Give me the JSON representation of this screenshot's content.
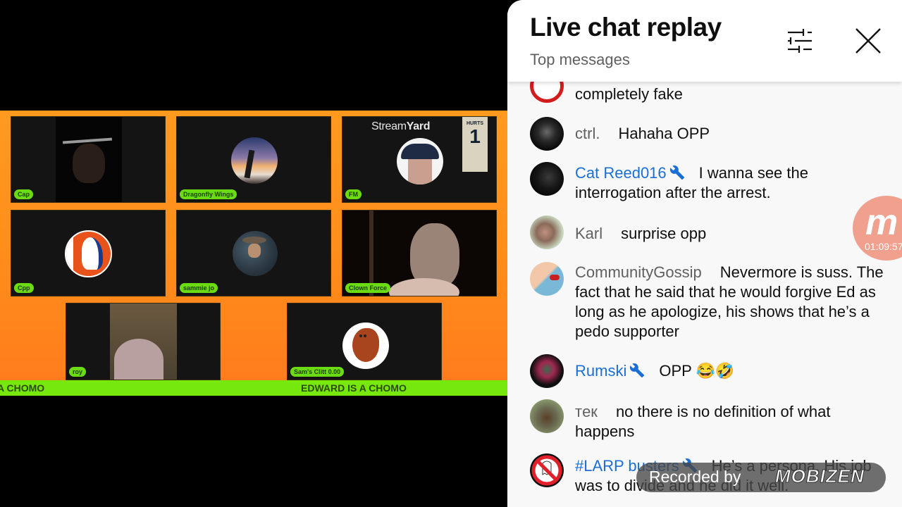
{
  "video": {
    "participants": [
      {
        "name": "Cap",
        "type": "camera"
      },
      {
        "name": "Dragonfly Wings",
        "type": "avatar"
      },
      {
        "name": "FM",
        "type": "avatar"
      },
      {
        "name": "Cpp",
        "type": "avatar"
      },
      {
        "name": "sammie jo",
        "type": "avatar"
      },
      {
        "name": "Clown Force",
        "type": "camera"
      },
      {
        "name": "roy",
        "type": "camera"
      },
      {
        "name": "Sam's Clitt 0.00",
        "type": "avatar"
      }
    ],
    "watermark": {
      "light": "Stream",
      "bold": "Yard"
    },
    "jersey": {
      "name": "HURTS",
      "number": "1"
    },
    "ticker": {
      "left_text": "A CHOMO",
      "right_text": "EDWARD IS A CHOMO"
    },
    "colors": {
      "background": "#ff8c1a",
      "ticker": "#77e80d",
      "name_tag": "#6cdc12"
    }
  },
  "chat": {
    "title": "Live chat replay",
    "subtitle": "Top messages",
    "filter_icon": "tune-icon",
    "close_icon": "close-icon",
    "moderator_color": "#1a6fd6",
    "messages": [
      {
        "author": "",
        "text": "completely fake",
        "moderator": false,
        "avatar": "ghostbusters-logo"
      },
      {
        "author": "ctrl.",
        "text": "Hahaha OPP",
        "moderator": false,
        "avatar": "dark-mask"
      },
      {
        "author": "Cat Reed016",
        "text": "I wanna see the interrogation after the arrest.",
        "moderator": true,
        "avatar": "black-cat"
      },
      {
        "author": "Karl",
        "text": "surprise opp",
        "moderator": false,
        "avatar": "man-photo"
      },
      {
        "author": "CommunityGossip",
        "text": "Nevermore is suss. The fact that he said that he would forgive Ed as long as he apologize, his shows that he’s a pedo supporter",
        "moderator": false,
        "avatar": "gossip-comic"
      },
      {
        "author": "Rumski",
        "text": "OPP 😂🤣",
        "moderator": true,
        "avatar": "skull-art"
      },
      {
        "author": "тeк",
        "text": "no there is no definition of what happens",
        "moderator": false,
        "avatar": "cthulhu-art"
      },
      {
        "author": "#LARP busters",
        "text": "He’s a persona. His job was to divide and he did it well.",
        "moderator": true,
        "avatar": "ghostbusters-logo"
      }
    ]
  },
  "overlays": {
    "mobizen_timer": "01:09:57",
    "recorded_label": "Recorded by",
    "recorded_brand": "MOBIZEN"
  }
}
